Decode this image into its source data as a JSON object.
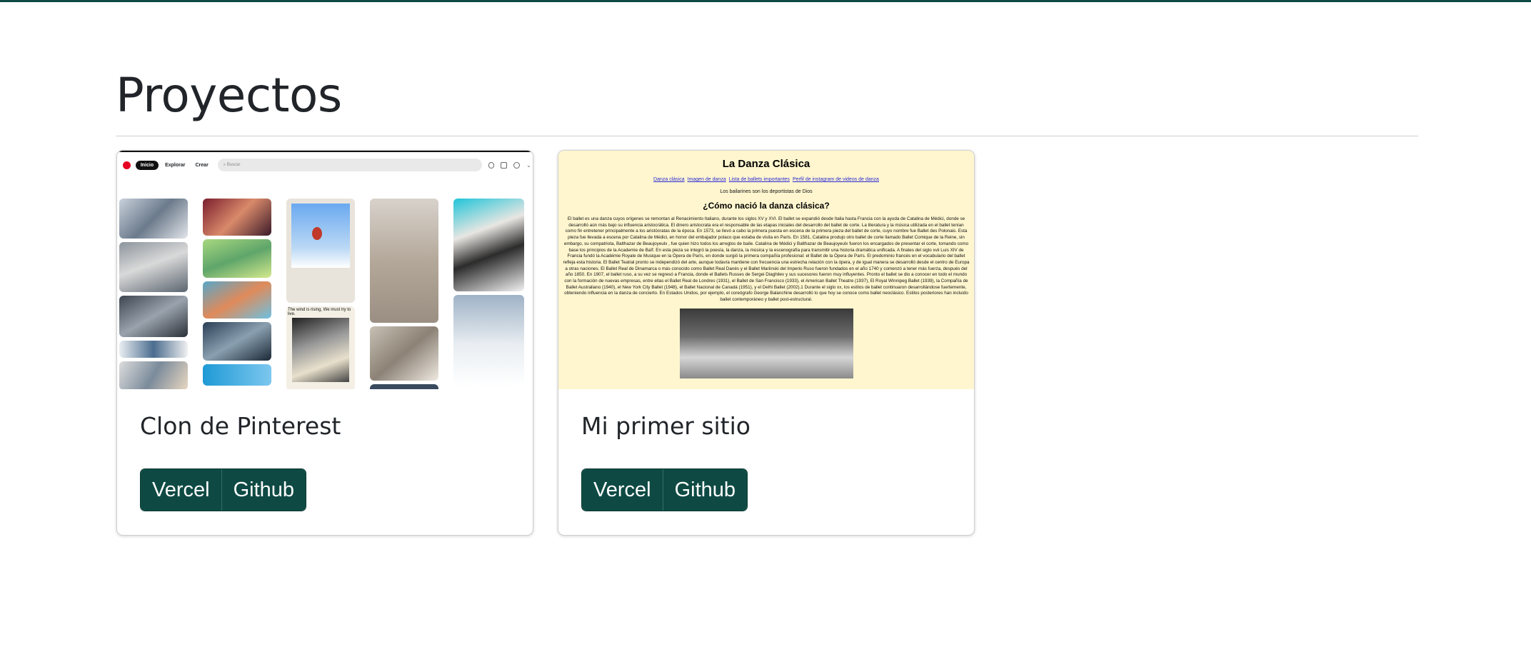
{
  "page": {
    "title": "Proyectos"
  },
  "projects": [
    {
      "title": "Clon de Pinterest",
      "buttons": {
        "vercel": "Vercel",
        "github": "Github"
      },
      "preview": {
        "nav": [
          "Inicio",
          "Explorar",
          "Crear"
        ],
        "search_placeholder": "Buscar",
        "caption": "The wind is rising, We must try to live."
      }
    },
    {
      "title": "Mi primer sitio",
      "buttons": {
        "vercel": "Vercel",
        "github": "Github"
      },
      "preview": {
        "title": "La Danza Clásica",
        "links": [
          "Danza clásica",
          "Imagen de danza",
          "Lista de ballets importantes",
          "Perfil de instagram de videos de danza"
        ],
        "tagline": "Los bailarines son los deportistas de Dios",
        "subtitle": "¿Cómo nació la danza clásica?",
        "paragraph": "El ballet es una danza cuyos orígenes se remontan al Renacimiento Italiano, durante los siglos XV y XVI. El ballet se expandió desde Italia hasta Francia con la ayuda de Catalina de Médici, donde se desarrolló aún más bajo su influencia aristocrática. El dinero aristocrata era el responsable de las etapas iniciales del desarrollo del ballet de corte. La literatura y la música utilizada en el ballet tenían como fin entretener principalmente a los aristócratas de la época. En 1573, se llevó a cabo la primera puesta en escena de la primera pieza del ballet de corte, cuyo nombre fue Ballet des Polonais. Esta pieza fue llevada a escena por Catalina de Médici, en honor del embajador polaco que estaba de visita en París. En 1581, Catalina produjo otro ballet de corte llamado Ballet Comique de la Reine, sin embargo, su compatriota, Balthazar de Beaujoyeulx , fue quien hizo todos los arreglos de baile. Catalina de Médici y Balthazar de Beaujoyeulx fueron los encargados de presentar el corte, tomando como base los principios de la Academie de Baïf. En esta pieza se integró la poesía, la danza, la música y la escenografía para transmitir una historia dramática unificada. A finales del siglo xvii Luis XIV de Francia fundó la Académie Royale de Musique en la Ópera de París, en donde surgió la primera compañía profesional: el Ballet de la Ópera de París. El predominio francés en el vocabulario del ballet refleja esta historia. El Ballet Teatral pronto se independizó del arte, aunque todavía mantiene con frecuencia una estrecha relación con la ópera, y de igual manera se desarrolló desde el centro de Europa a otras naciones. El Ballet Real de Dinamarca o más conocido como Ballet Real Danés y el Ballet Mariinski del Imperio Ruso fueron fundados en el año 1740 y comenzó a tener más fuerza, después del año 1850. En 1907, el ballet ruso, a su vez se regresó a Francia, donde el Ballets Russes de Sergei Diaghilev y sus sucesores fueron muy influyentes. Pronto el ballet se dio a conocer en todo el mundo con la formación de nuevas empresas, entre ellas el Ballet Real de Londres (1931), el Ballet de San Francisco (1933), el American Ballet Theatre (1937), El Royal Winnipeg Ballet (1939), la Compañía de Ballet Australiano (1940), el New York City Ballet (1948), el Ballet Nacional de Canadá (1951), y el Delhi Ballet (2002).1 Durante el siglo xx, los estilos de ballet continuaron desarrollándose fuertemente, obteniendo influencia en la danza de concierto. En Estados Unidos, por ejemplo, el coreógrafo George Balanchine desarrolló lo que hoy se conoce como ballet neoclásico. Estilos posteriores han incluido ballet contemporáneo y ballet post-estructural."
      }
    }
  ]
}
